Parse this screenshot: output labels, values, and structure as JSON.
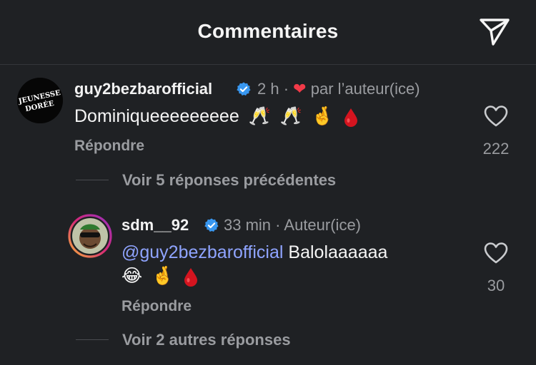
{
  "header": {
    "title": "Commentaires"
  },
  "comment": {
    "username": "guy2bezbarofficial",
    "time": "2 h",
    "liked_by_author": "par l’auteur(ice)",
    "text": "Dominiqueeeeeeeee",
    "emojis": [
      "🥂",
      "🥂",
      "🤞",
      "drop"
    ],
    "reply_label": "Répondre",
    "likes": "222",
    "avatar_text": "JEUNESSE DORÉE"
  },
  "thread_prev": {
    "label": "Voir 5 réponses précédentes"
  },
  "reply": {
    "username": "sdm__92",
    "time": "33 min",
    "author_tag": "Auteur(ice)",
    "mention": "@guy2bezbarofficial",
    "text": "Balolaaaaaa",
    "emojis": [
      "😂",
      "🤞",
      "drop"
    ],
    "reply_label": "Répondre",
    "likes": "30"
  },
  "thread_more": {
    "label": "Voir 2 autres réponses"
  },
  "colors": {
    "verified": "#3897f0",
    "heart": "#f23a48",
    "mention": "#8fa4ff",
    "story_ring": [
      "#f7b13b",
      "#d62976",
      "#962fbf"
    ]
  }
}
